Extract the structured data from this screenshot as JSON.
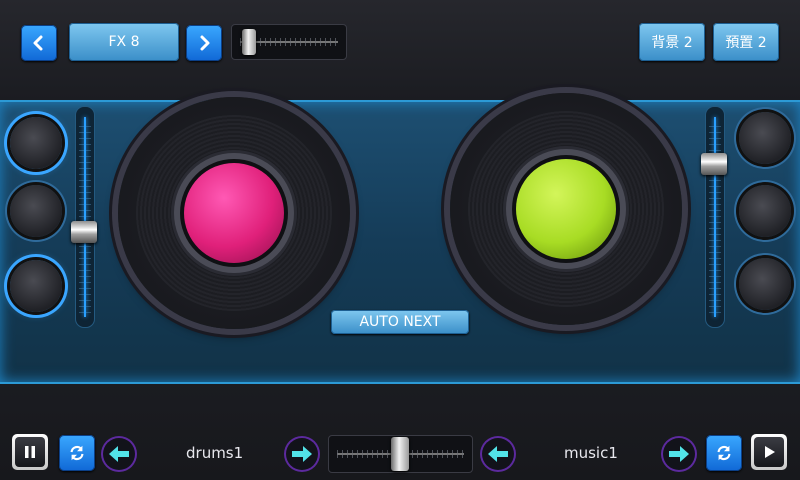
{
  "top": {
    "fx_label": "FX 8",
    "bg_label": "背景 2",
    "preset_label": "預置 2"
  },
  "center": {
    "auto_next_label": "AUTO NEXT"
  },
  "bottom": {
    "left_track": "drums1",
    "right_track": "music1"
  },
  "levels": {
    "fx_slider": 0.12,
    "left_volume": 0.45,
    "right_volume": 0.8,
    "crossfader": 0.5
  },
  "colors": {
    "accent": "#2aa0ff",
    "left_platter": "#e0207a",
    "right_platter": "#a8dc24",
    "arrow": "#52e3e8"
  },
  "icons": [
    "chevron-left-icon",
    "chevron-right-icon",
    "pause-icon",
    "sync-icon",
    "arrow-left-icon",
    "arrow-right-icon",
    "play-icon"
  ]
}
